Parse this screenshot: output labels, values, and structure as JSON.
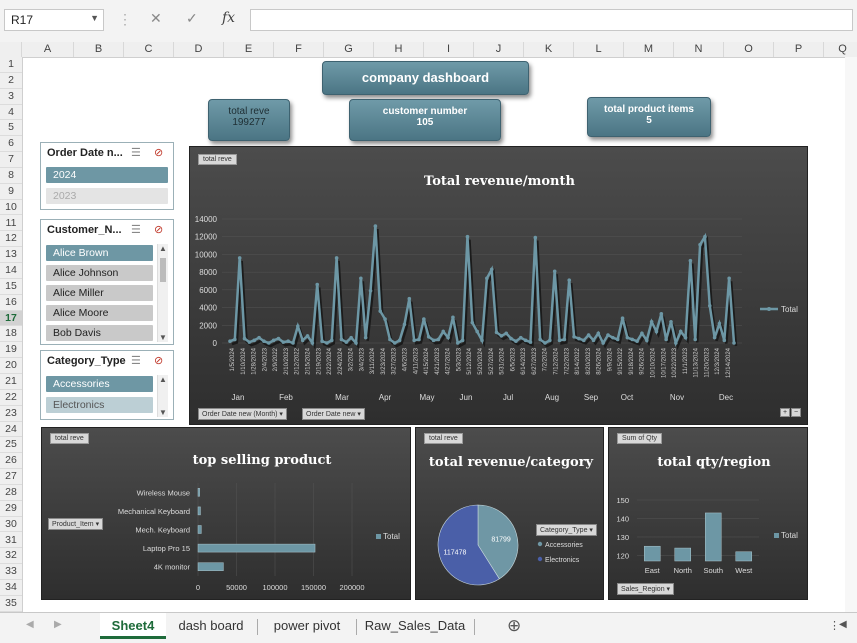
{
  "formula_bar": {
    "cell_ref": "R17",
    "cancel_icon": "✕",
    "enter_icon": "✓",
    "fx_label": "fx",
    "formula": ""
  },
  "columns": [
    "A",
    "B",
    "C",
    "D",
    "E",
    "F",
    "G",
    "H",
    "I",
    "J",
    "K",
    "L",
    "M",
    "N",
    "O",
    "P",
    "Q"
  ],
  "rows": [
    "1",
    "2",
    "3",
    "4",
    "5",
    "6",
    "7",
    "8",
    "9",
    "10",
    "11",
    "12",
    "13",
    "14",
    "15",
    "16",
    "17",
    "18",
    "19",
    "20",
    "21",
    "22",
    "23",
    "24",
    "25",
    "26",
    "27",
    "28",
    "29",
    "30",
    "31",
    "32",
    "33",
    "34",
    "35"
  ],
  "selected_row": "17",
  "dashboard": {
    "title": "company dashboard",
    "kpis": [
      {
        "label": "total reve",
        "value": "199277"
      },
      {
        "label": "customer number",
        "value": "105"
      },
      {
        "label": "total product items",
        "value": "5"
      }
    ]
  },
  "slicers": {
    "order_date": {
      "title": "Order Date n...",
      "items": [
        "2024",
        "2023"
      ]
    },
    "customer": {
      "title": "Customer_N...",
      "items": [
        "Alice Brown",
        "Alice Johnson",
        "Alice Miller",
        "Alice Moore",
        "Bob Davis"
      ]
    },
    "category": {
      "title": "Category_Type",
      "items": [
        "Accessories",
        "Electronics"
      ]
    }
  },
  "chart_data": [
    {
      "type": "line",
      "field_tag": "total reve",
      "title": "Total revenue/month",
      "legend": "Total",
      "legend_position": "right",
      "ylim": [
        0,
        14000
      ],
      "yticks": [
        "0",
        "2000",
        "4000",
        "6000",
        "8000",
        "10000",
        "12000",
        "14000"
      ],
      "x_date_labels": [
        "1/5/2024",
        "1/10/2024",
        "1/28/2024",
        "2/4/2023",
        "2/9/2022",
        "2/10/2023",
        "2/12/2022",
        "2/15/2024",
        "2/19/2023",
        "2/22/2024",
        "2/24/2024",
        "3/2/2024",
        "3/4/2023",
        "3/11/2024",
        "3/23/2024",
        "3/27/2023",
        "4/6/2023",
        "4/11/2023",
        "4/15/2024",
        "4/21/2023",
        "4/27/2024",
        "5/3/2023",
        "5/12/2024",
        "5/20/2024",
        "5/27/2024",
        "5/31/2024",
        "6/5/2023",
        "6/14/2023",
        "6/27/2023",
        "7/2/2024",
        "7/12/2024",
        "7/22/2023",
        "8/14/2022",
        "8/20/2023",
        "8/26/2024",
        "9/9/2024",
        "9/15/2022",
        "9/18/2024",
        "9/26/2024",
        "10/10/2024",
        "10/17/2024",
        "10/22/2023",
        "11/1/2023",
        "11/13/2024",
        "11/20/2023",
        "12/3/2024",
        "12/14/2024"
      ],
      "months": [
        "Jan",
        "Feb",
        "Mar",
        "Apr",
        "May",
        "Jun",
        "Jul",
        "Aug",
        "Sep",
        "Oct",
        "Nov",
        "Dec"
      ],
      "series": [
        {
          "name": "Total",
          "values": [
            200,
            400,
            9600,
            500,
            100,
            300,
            600,
            200,
            0,
            300,
            500,
            100,
            200,
            0,
            1900,
            300,
            800,
            0,
            6600,
            200,
            0,
            300,
            9600,
            400,
            100,
            600,
            0,
            7300,
            600,
            5900,
            13200,
            3600,
            2700,
            400,
            0,
            300,
            2100,
            5000,
            300,
            400,
            2700,
            700,
            300,
            400,
            1300,
            600,
            2900,
            0,
            300,
            12000,
            2300,
            1300,
            300,
            7300,
            8300,
            1200,
            800,
            1100,
            500,
            200,
            600,
            300,
            100,
            11900,
            400,
            0,
            300,
            8100,
            300,
            400,
            7100,
            700,
            500,
            300,
            900,
            300,
            1100,
            0,
            900,
            600,
            400,
            2800,
            600,
            400,
            200,
            1100,
            300,
            2400,
            1300,
            3300,
            400,
            2400,
            0,
            1300,
            600,
            9300,
            400,
            11100,
            12000,
            4200,
            600,
            2200,
            300,
            7300,
            0
          ]
        }
      ],
      "buttons": [
        "Order Date new (Month)",
        "Order Date new"
      ]
    },
    {
      "type": "bar",
      "field_tag": "total reve",
      "title": "top selling product",
      "filter_button": "Product_Item",
      "legend": "Total",
      "categories": [
        "Wireless Mouse",
        "Mechanical Keyboard",
        "Mech. Keyboard",
        "Laptop Pro 15",
        "4K monitor"
      ],
      "values": [
        2100,
        3200,
        4300,
        152000,
        33000
      ],
      "xticks": [
        "0",
        "50000",
        "100000",
        "150000",
        "200000"
      ],
      "xlim": [
        0,
        200000
      ]
    },
    {
      "type": "pie",
      "field_tag": "total reve",
      "title": "total revenue/category",
      "filter_button": "Category_Type",
      "categories": [
        "Accessories",
        "Electronics"
      ],
      "values": [
        81799,
        117478
      ],
      "colors": [
        "#6f97a5",
        "#4a5fa8"
      ]
    },
    {
      "type": "bar",
      "field_tag": "Sum of Qty",
      "title": "total qty/region",
      "filter_button": "Sales_Region",
      "legend": "Total",
      "categories": [
        "East",
        "North",
        "South",
        "West"
      ],
      "values": [
        125,
        124,
        143,
        122
      ],
      "yticks": [
        "120",
        "130",
        "140",
        "150"
      ],
      "ylim": [
        115,
        150
      ]
    }
  ],
  "sheet_tabs": [
    "Sheet4",
    "dash board",
    "power pivot",
    "Raw_Sales_Data"
  ],
  "active_tab": "Sheet4",
  "add_sheet_icon": "⊕"
}
